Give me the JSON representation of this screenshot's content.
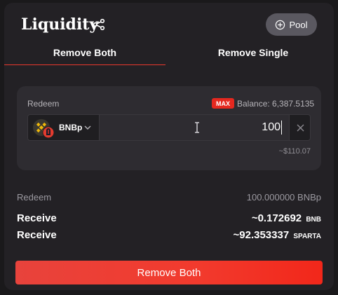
{
  "header": {
    "title": "Liquidity",
    "share_icon": "share-icon",
    "pool_button": {
      "icon": "plus-circle-icon",
      "label": "Pool"
    }
  },
  "tabs": [
    {
      "label": "Remove Both",
      "active": true
    },
    {
      "label": "Remove Single",
      "active": false
    }
  ],
  "redeem_panel": {
    "label": "Redeem",
    "max_label": "MAX",
    "balance": "Balance: 6,387.5135",
    "token": {
      "name": "BNBp",
      "icon": "bnb-sparta-token-icon"
    },
    "amount": "100",
    "usd_value": "~$110.07"
  },
  "summary": {
    "redeem": {
      "label": "Redeem",
      "value": "100.000000 BNBp"
    },
    "receive_1": {
      "label": "Receive",
      "value": "~0.172692",
      "unit": "BNB"
    },
    "receive_2": {
      "label": "Receive",
      "value": "~92.353337",
      "unit": "SPARTA"
    }
  },
  "action_button": {
    "label": "Remove Both"
  },
  "colors": {
    "accent": "#e8382d",
    "card_bg": "#232125",
    "panel_bg": "#2e2c31",
    "max_badge": "#e5281f"
  }
}
